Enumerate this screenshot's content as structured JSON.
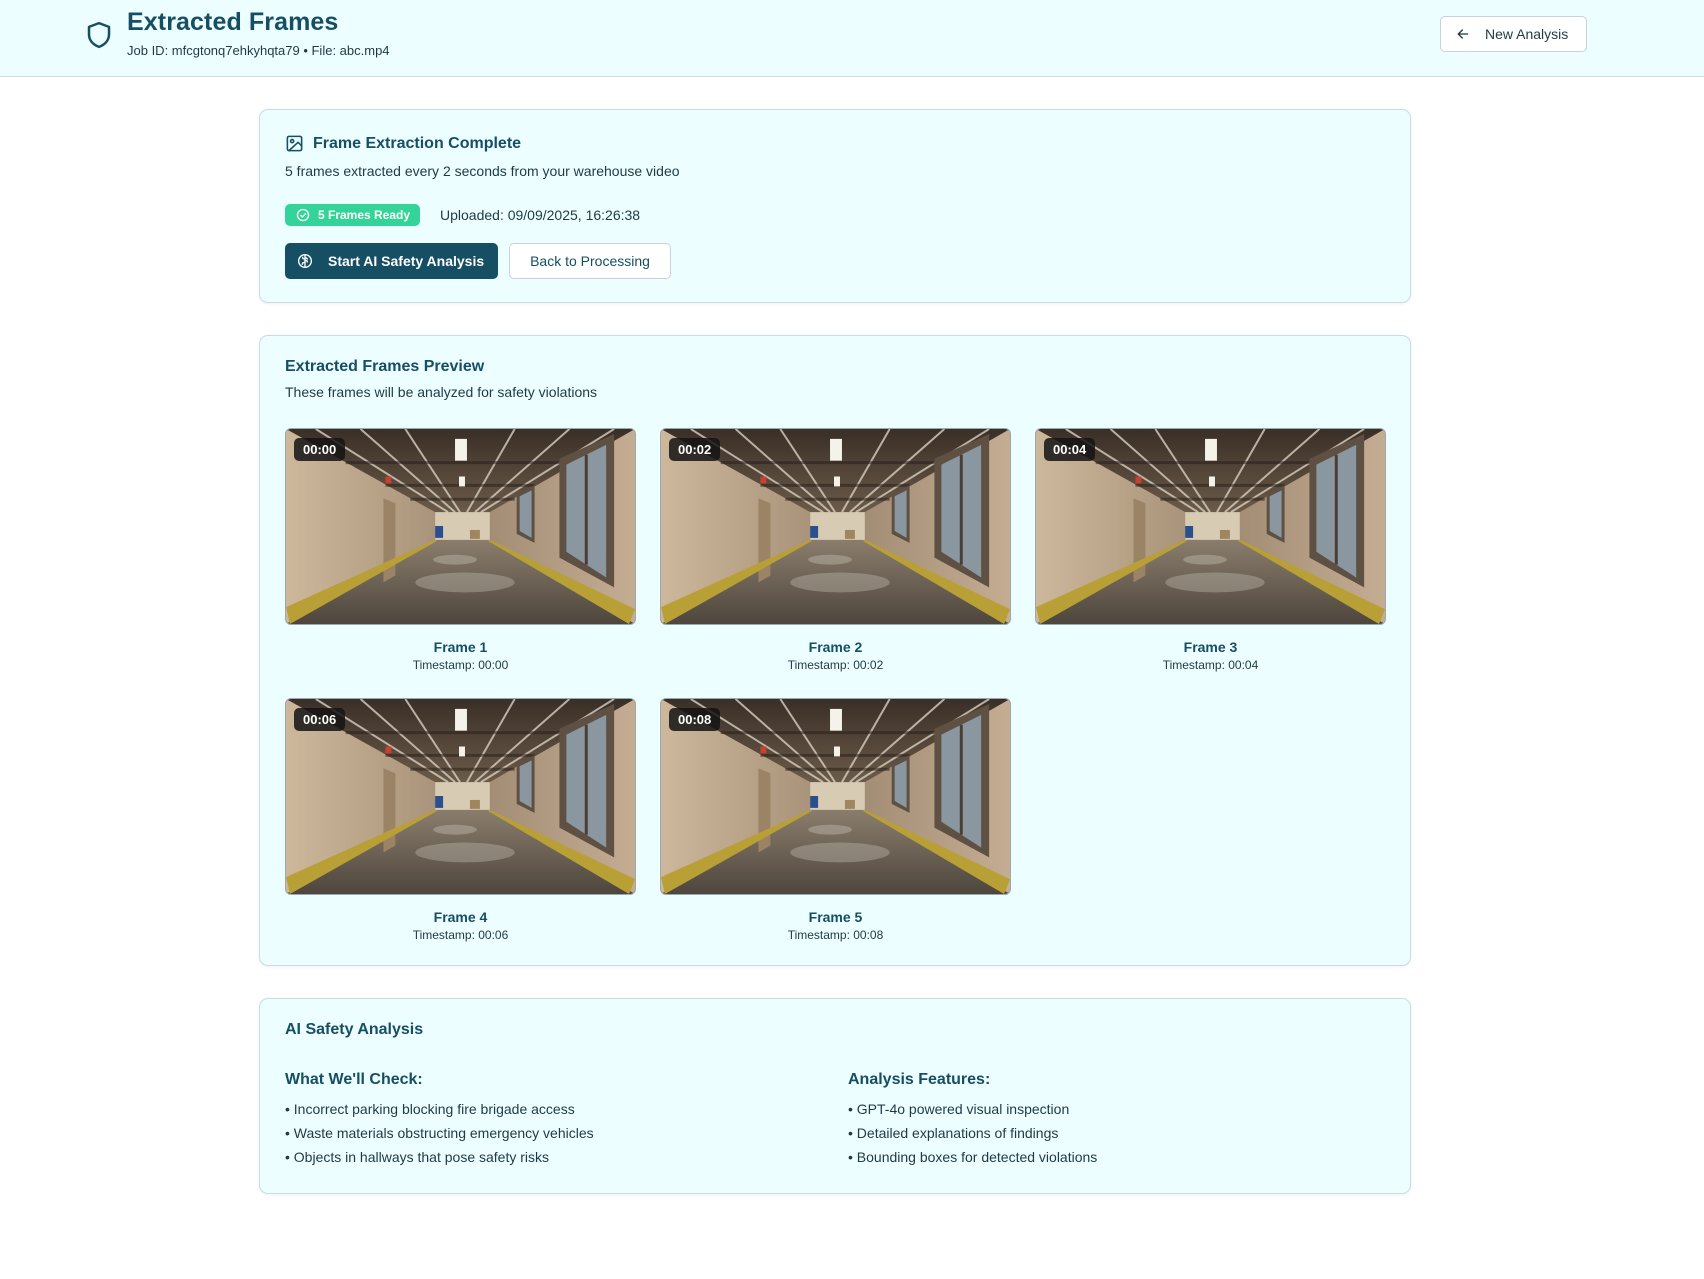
{
  "header": {
    "title": "Extracted Frames",
    "meta": "Job ID: mfcgtonq7ehkyhqta79 • File: abc.mp4",
    "new_analysis_label": "New Analysis"
  },
  "extraction": {
    "title": "Frame Extraction Complete",
    "subtitle": "5 frames extracted every 2 seconds from your warehouse video",
    "badge": "5 Frames Ready",
    "uploaded": "Uploaded: 09/09/2025, 16:26:38",
    "start_label": "Start AI Safety Analysis",
    "back_label": "Back to Processing"
  },
  "preview": {
    "title": "Extracted Frames Preview",
    "subtitle": "These frames will be analyzed for safety violations",
    "frames": [
      {
        "badge": "00:00",
        "name": "Frame 1",
        "timestamp": "Timestamp: 00:00"
      },
      {
        "badge": "00:02",
        "name": "Frame 2",
        "timestamp": "Timestamp: 00:02"
      },
      {
        "badge": "00:04",
        "name": "Frame 3",
        "timestamp": "Timestamp: 00:04"
      },
      {
        "badge": "00:06",
        "name": "Frame 4",
        "timestamp": "Timestamp: 00:06"
      },
      {
        "badge": "00:08",
        "name": "Frame 5",
        "timestamp": "Timestamp: 00:08"
      }
    ]
  },
  "analysis": {
    "title": "AI Safety Analysis",
    "check_title": "What We'll Check:",
    "check_items": [
      "• Incorrect parking blocking fire brigade access",
      "• Waste materials obstructing emergency vehicles",
      "• Objects in hallways that pose safety risks"
    ],
    "features_title": "Analysis Features:",
    "feature_items": [
      "• GPT-4o powered visual inspection",
      "• Detailed explanations of findings",
      "• Bounding boxes for detected violations"
    ]
  },
  "colors": {
    "primary": "#164e63",
    "background_tint": "#ecfeff",
    "success": "#34d399"
  },
  "icons": [
    "shield-icon",
    "arrow-left-icon",
    "image-icon",
    "check-circle-icon",
    "brain-icon"
  ]
}
